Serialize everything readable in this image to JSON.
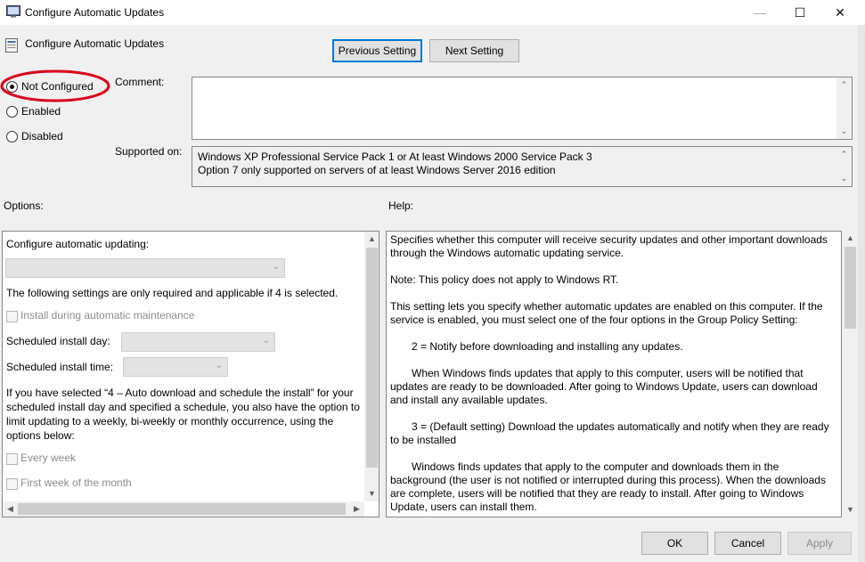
{
  "window": {
    "title": "Configure Automatic Updates"
  },
  "header": {
    "policy_title": "Configure Automatic Updates",
    "prev_label": "Previous Setting",
    "next_label": "Next Setting"
  },
  "state": {
    "options": [
      "Not Configured",
      "Enabled",
      "Disabled"
    ],
    "selected": "Not Configured",
    "highlight_color": "#d9001b"
  },
  "comment": {
    "label": "Comment:",
    "value": ""
  },
  "supported": {
    "label": "Supported on:",
    "lines": [
      "Windows XP Professional Service Pack 1 or At least Windows 2000 Service Pack 3",
      "Option 7 only supported on servers of at least Windows Server 2016 edition"
    ]
  },
  "sections": {
    "options_label": "Options:",
    "help_label": "Help:"
  },
  "options": {
    "configure_label": "Configure automatic updating:",
    "configure_value": "",
    "note": "The following settings are only required and applicable if 4 is selected.",
    "install_maintenance": "Install during automatic maintenance",
    "day_label": "Scheduled install day:",
    "day_value": "",
    "time_label": "Scheduled install time:",
    "time_value": "",
    "para": "If you have selected “4 – Auto download and schedule the install” for your scheduled install day and specified a schedule, you also have the option to limit updating to a weekly, bi-weekly or monthly occurrence, using the options below:",
    "every_week": "Every week",
    "first_week": "First week of the month"
  },
  "help": {
    "paragraphs": [
      {
        "text": "Specifies whether this computer will receive security updates and other important downloads through the Windows automatic updating service.",
        "indent": false
      },
      {
        "text": "Note: This policy does not apply to Windows RT.",
        "indent": false
      },
      {
        "text": "This setting lets you specify whether automatic updates are enabled on this computer. If the service is enabled, you must select one of the four options in the Group Policy Setting:",
        "indent": false
      },
      {
        "text": "2 = Notify before downloading and installing any updates.",
        "indent": true
      },
      {
        "text": "When Windows finds updates that apply to this computer, users will be notified that updates are ready to be downloaded. After going to Windows Update, users can download and install any available updates.",
        "indent": true
      },
      {
        "text": "3 = (Default setting) Download the updates automatically and notify when they are ready to be installed",
        "indent": true
      },
      {
        "text": "Windows finds updates that apply to the computer and downloads them in the background (the user is not notified or interrupted during this process). When the downloads are complete, users will be notified that they are ready to install. After going to Windows Update, users can install them.",
        "indent": true
      }
    ]
  },
  "footer": {
    "ok": "OK",
    "cancel": "Cancel",
    "apply": "Apply"
  }
}
